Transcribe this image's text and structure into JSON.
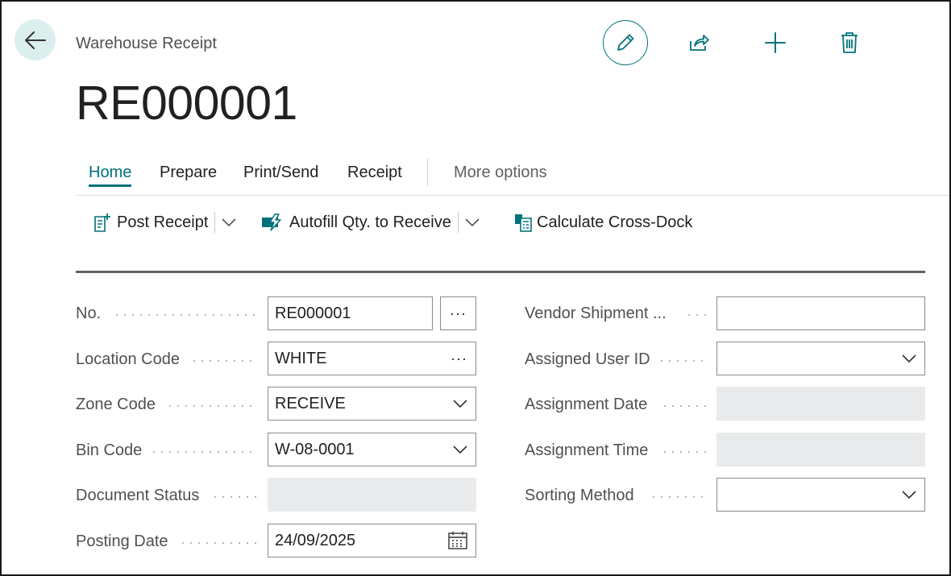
{
  "header": {
    "caption": "Warehouse Receipt",
    "title": "RE000001",
    "back_icon": "arrow-left-icon",
    "actions": {
      "edit_icon": "pencil-icon",
      "share_icon": "share-icon",
      "new_icon": "plus-icon",
      "delete_icon": "trash-icon"
    }
  },
  "tabs": [
    {
      "label": "Home",
      "active": true
    },
    {
      "label": "Prepare"
    },
    {
      "label": "Print/Send"
    },
    {
      "label": "Receipt"
    },
    {
      "label": "More options"
    }
  ],
  "commands": {
    "post_receipt": "Post Receipt",
    "autofill": "Autofill Qty. to Receive",
    "cross_dock": "Calculate Cross-Dock"
  },
  "form": {
    "left": {
      "no": {
        "label": "No.",
        "value": "RE000001",
        "assist": "···"
      },
      "location_code": {
        "label": "Location Code",
        "value": "WHITE",
        "assist": "···"
      },
      "zone_code": {
        "label": "Zone Code",
        "value": "RECEIVE"
      },
      "bin_code": {
        "label": "Bin Code",
        "value": "W-08-0001"
      },
      "document_status": {
        "label": "Document Status",
        "value": ""
      },
      "posting_date": {
        "label": "Posting Date",
        "value": "24/09/2025"
      }
    },
    "right": {
      "vendor_shipment": {
        "label": "Vendor Shipment ...",
        "value": ""
      },
      "assigned_user_id": {
        "label": "Assigned User ID",
        "value": ""
      },
      "assignment_date": {
        "label": "Assignment Date",
        "value": ""
      },
      "assignment_time": {
        "label": "Assignment Time",
        "value": ""
      },
      "sorting_method": {
        "label": "Sorting Method",
        "value": ""
      }
    }
  },
  "colors": {
    "accent": "#00727a",
    "back_button_bg": "#dcefef",
    "readonly_bg": "#e8eaeb"
  }
}
